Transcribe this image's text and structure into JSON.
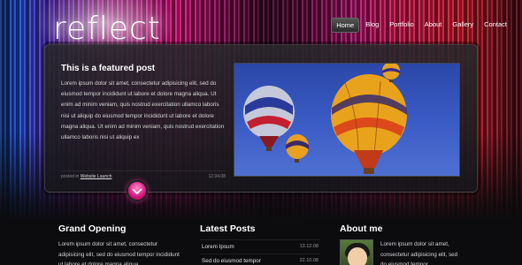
{
  "site": {
    "logo": "reflect"
  },
  "nav": {
    "items": [
      {
        "label": "Home",
        "active": true
      },
      {
        "label": "Blog"
      },
      {
        "label": "Portfolio"
      },
      {
        "label": "About"
      },
      {
        "label": "Gallery"
      },
      {
        "label": "Contact"
      }
    ]
  },
  "featured": {
    "title": "This is a featured post",
    "text": "Lorem ipsum dolor sit amet, consectetur adipisicing elit, sed do eiusmod tempor incididunt ut labore et dolore magna aliqua. Ut enim ad minim veniam, quis nostrud exercitation ullamco laboris nisi ut aliquip do eiusmod tempor incididunt ut labore et dolore magna aliqua. Ut enim ad minim veniam, quis nostrud exercitation ullamco laboris nisi ut aliquip ex",
    "posted_in": "posted in",
    "category": "Website Launch",
    "date": "12.04.08"
  },
  "grand_opening": {
    "title": "Grand Opening",
    "text": "Lorem ipsum dolor sit amet, consectetur adipisicing elit, sed do eiusmod tempor incididunt ut labore et dolore magna aliqua"
  },
  "latest_posts": {
    "title": "Latest Posts",
    "posts": [
      {
        "title": "Lorem Ipsum",
        "date": "13.12.08"
      },
      {
        "title": "Sed do eiusmod tempor",
        "date": "22.10.08"
      }
    ]
  },
  "about": {
    "title": "About me",
    "text": "Lorem ipsum dolor sit amet, consectetur adipisicing elit, sed do eiusmod tempor"
  },
  "colors": {
    "accent": "#d6157f",
    "background": "#0b0b0d"
  }
}
